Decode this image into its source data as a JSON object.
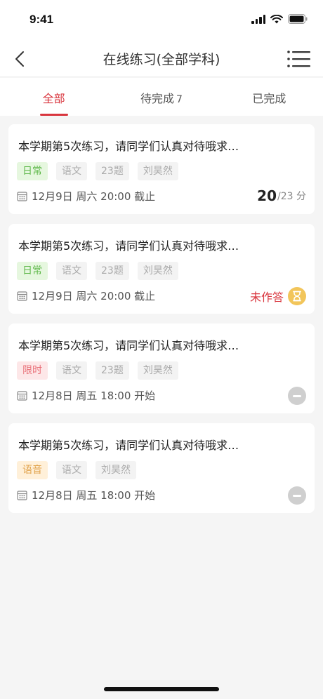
{
  "status": {
    "time": "9:41"
  },
  "nav": {
    "title": "在线练习(全部学科)"
  },
  "tabs": [
    {
      "label": "全部",
      "count": "",
      "active": true
    },
    {
      "label": "待完成",
      "count": "7",
      "active": false
    },
    {
      "label": "已完成",
      "count": "",
      "active": false
    }
  ],
  "cards": [
    {
      "title": "本学期第5次练习，请同学们认真对待哦求…",
      "tags": [
        "日常",
        "语文",
        "23题",
        "刘昊然"
      ],
      "date": "12月9日 周六 20:00 截止",
      "score": "20",
      "total": "/23 分"
    },
    {
      "title": "本学期第5次练习，请同学们认真对待哦求…",
      "tags": [
        "日常",
        "语文",
        "23题",
        "刘昊然"
      ],
      "date": "12月9日 周六 20:00 截止",
      "status": "未作答"
    },
    {
      "title": "本学期第5次练习，请同学们认真对待哦求…",
      "tags": [
        "限时",
        "语文",
        "23题",
        "刘昊然"
      ],
      "date": "12月8日 周五 18:00 开始"
    },
    {
      "title": "本学期第5次练习，请同学们认真对待哦求…",
      "tags": [
        "语音",
        "语文",
        "刘昊然"
      ],
      "date": "12月8日 周五 18:00 开始"
    }
  ],
  "colors": {
    "accent": "#d9363e",
    "daily": "#5fb84a",
    "timed": "#e97078",
    "voice": "#e0a24a",
    "hourglass": "#f2c55a"
  },
  "icons": [
    "back-arrow-icon",
    "menu-icon",
    "calendar-icon",
    "hourglass-icon",
    "minus-circle-icon",
    "signal-icon",
    "wifi-icon",
    "battery-icon"
  ]
}
